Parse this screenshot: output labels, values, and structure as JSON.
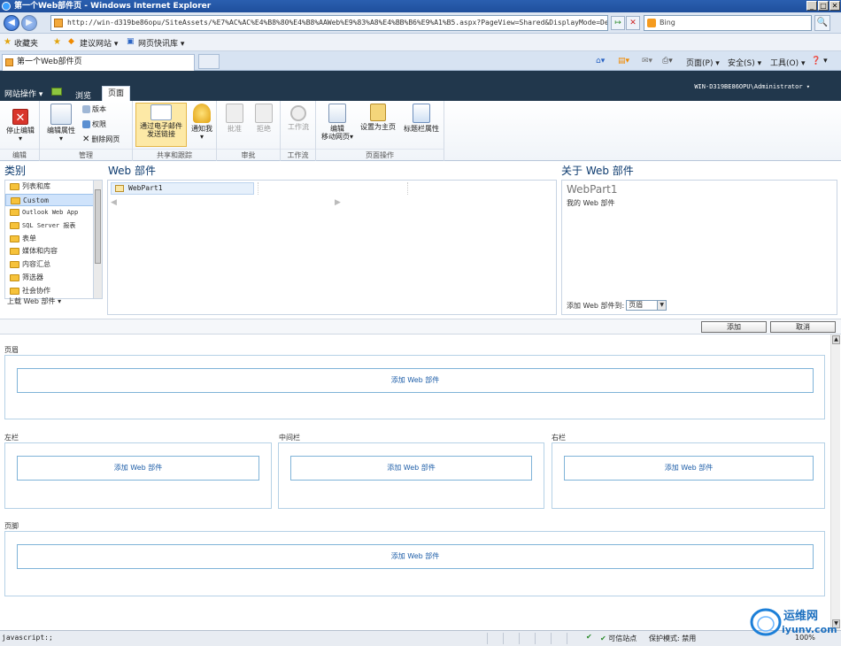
{
  "window": {
    "title": "第一个Web部件页 - Windows Internet Explorer",
    "min": "_",
    "max": "□",
    "close": "✕"
  },
  "addressbar": {
    "url": "http://win-d319be86opu/SiteAssets/%E7%AC%AC%E4%B8%80%E4%B8%AAWeb%E9%83%A8%E4%BB%B6%E9%A1%B5.aspx?PageView=Shared&DisplayMode=Design&In",
    "search_placeholder": "Bing",
    "go": "↦",
    "stop": "✕",
    "search_btn": "🔍"
  },
  "favorites": {
    "label": "收藏夹",
    "items": [
      "建议网站 ▾",
      "网页快讯库 ▾"
    ]
  },
  "tab": {
    "title": "第一个Web部件页"
  },
  "commandbar": {
    "page": "页面(P) ▾",
    "safety": "安全(S) ▾",
    "tools": "工具(O) ▾",
    "help": "❓ ▾"
  },
  "sp": {
    "site_actions": "网站操作 ▾",
    "browse": "浏览",
    "page_tab": "页面",
    "user": "WIN-D319BE86OPU\\Administrator ▾"
  },
  "ribbon": {
    "groups": [
      {
        "label": "编辑"
      },
      {
        "label": "管理"
      },
      {
        "label": "共享和跟踪"
      },
      {
        "label": "审批"
      },
      {
        "label": "工作流"
      },
      {
        "label": "页面操作"
      }
    ],
    "stop_edit": "停止编辑",
    "stop_edit_arrow": "▾",
    "edit_props": "编辑属性",
    "edit_props_arrow": "▾",
    "versions": "版本",
    "permissions": "权限",
    "delete_page": "删除网页",
    "email_link_1": "通过电子邮件",
    "email_link_2": "发送链接",
    "alert_me": "通知我",
    "alert_arrow": "▾",
    "approve": "批准",
    "reject": "拒绝",
    "workflow": "工作流",
    "edit_mobile_1": "编辑",
    "edit_mobile_2": "移动网页▾",
    "make_homepage": "设置为主页",
    "title_props": "标题栏属性"
  },
  "adder": {
    "categories_head": "类别",
    "webparts_head": "Web 部件",
    "about_head": "关于 Web 部件",
    "categories": [
      "列表和库",
      "Custom",
      "Outlook Web App",
      "SQL Server 报表",
      "表单",
      "媒体和内容",
      "内容汇总",
      "筛选器",
      "社会协作"
    ],
    "selected_category": 1,
    "upload": "上载 Web 部件 ▾",
    "webpart_item": "WebPart1",
    "about_title": "WebPart1",
    "about_desc": "我的 Web 部件",
    "add_to_label": "添加 Web 部件到:",
    "zone_value": "页眉",
    "add_btn": "添加",
    "cancel_btn": "取消"
  },
  "zones": {
    "header": {
      "label": "页眉",
      "add": "添加 Web 部件"
    },
    "left": {
      "label": "左栏",
      "add": "添加 Web 部件"
    },
    "middle": {
      "label": "中间栏",
      "add": "添加 Web 部件"
    },
    "right": {
      "label": "右栏",
      "add": "添加 Web 部件"
    },
    "footer": {
      "label": "页脚",
      "add": "添加 Web 部件"
    }
  },
  "statusbar": {
    "left": "javascript:;",
    "trusted": "可信站点",
    "protected_mode": "保护模式: 禁用",
    "zoom": "100%"
  },
  "watermark": {
    "cn": "运维网",
    "en": "iyunv.com"
  }
}
